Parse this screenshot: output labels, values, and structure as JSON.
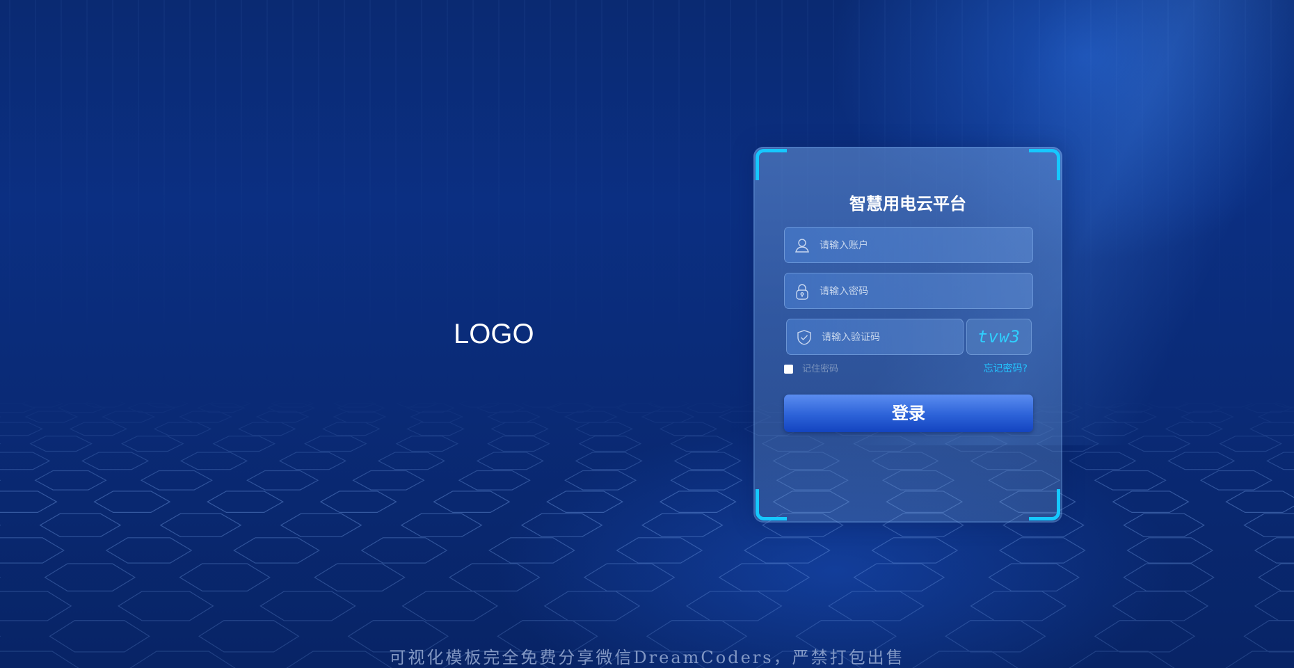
{
  "brand": {
    "logo_text": "LOGO"
  },
  "login": {
    "title": "智慧用电云平台",
    "account_placeholder": "请输入账户",
    "password_placeholder": "请输入密码",
    "captcha_placeholder": "请输入验证码",
    "captcha_code": "tvw3",
    "remember_label": "记住密码",
    "remember_checked": false,
    "forgot_label": "忘记密码?",
    "submit_label": "登录"
  },
  "footer": {
    "text": "可视化模板完全免费分享微信DreamCoders，严禁打包出售"
  },
  "colors": {
    "accent_cyan": "#16c8ff",
    "button_blue": "#2c62d8",
    "background": "#0b2f82"
  },
  "icons": {
    "account": "user-icon",
    "password": "lock-icon",
    "captcha": "shield-check-icon"
  }
}
